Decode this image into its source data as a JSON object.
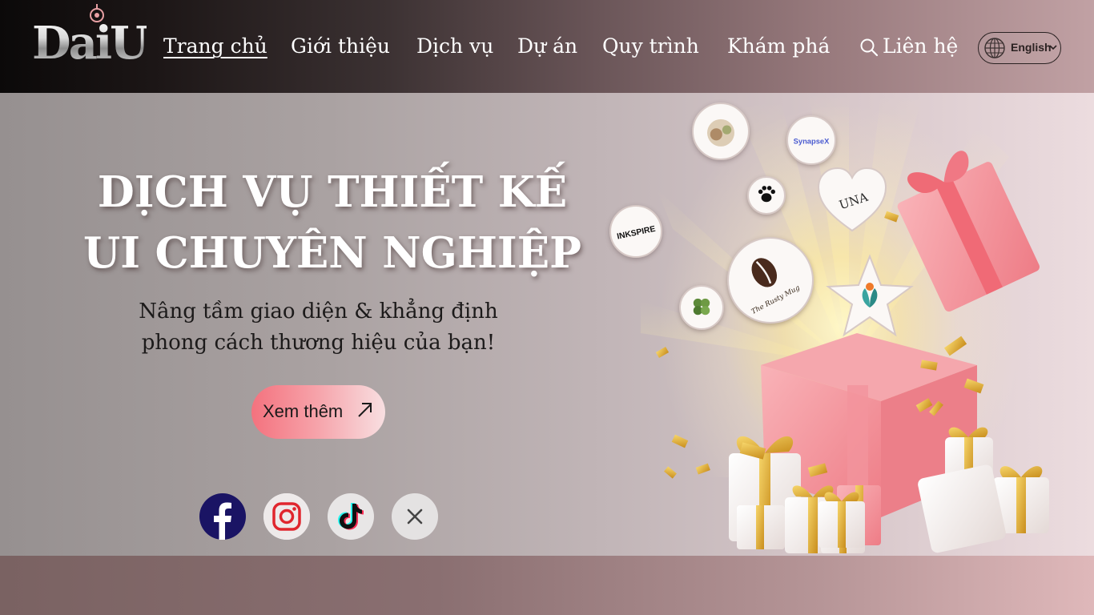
{
  "header": {
    "logo_text": "DaiU",
    "nav": [
      {
        "label": "Trang chủ",
        "active": true
      },
      {
        "label": "Giới thiệu",
        "active": false
      },
      {
        "label": "Dịch vụ",
        "active": false
      },
      {
        "label": "Dự án",
        "active": false
      },
      {
        "label": "Quy trình",
        "active": false
      },
      {
        "label": "Khám phá",
        "active": false
      },
      {
        "label": "Liên hệ",
        "active": false
      }
    ],
    "language": {
      "label": "English",
      "icon": "globe-icon"
    }
  },
  "hero": {
    "title_line1": "DỊCH VỤ THIẾT KẾ",
    "title_line2": "UI CHUYÊN NGHIỆP",
    "subtitle_line1": "Nâng tầm giao diện & khẳng định",
    "subtitle_line2": "phong cách thương hiệu của bạn!",
    "cta_label": "Xem thêm",
    "social": [
      {
        "name": "facebook",
        "icon": "facebook-icon",
        "color": "#1a1464"
      },
      {
        "name": "instagram",
        "icon": "instagram-icon",
        "color": "#e0262e"
      },
      {
        "name": "tiktok",
        "icon": "tiktok-icon",
        "color": "#111111"
      },
      {
        "name": "close",
        "icon": "close-icon",
        "color": "#555555"
      }
    ],
    "client_brands": [
      "INKSPIRE",
      "SynapseX",
      "The Rusty Mug",
      "UNA"
    ]
  },
  "colors": {
    "accent_pink": "#f4727e",
    "header_dark": "#0b0909",
    "gift_pink": "#f49aa2",
    "ribbon_gold": "#e2b23a"
  }
}
